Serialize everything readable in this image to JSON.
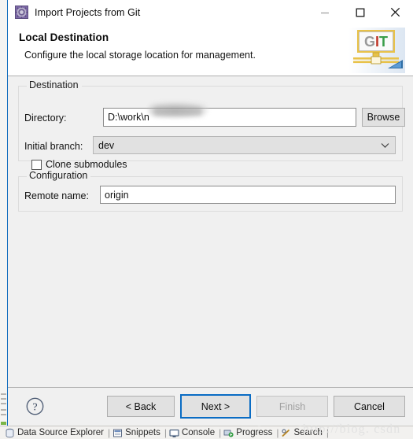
{
  "window": {
    "title": "Import Projects from Git",
    "icon": "eclipse-wizard-icon",
    "controls": {
      "minimize": "minimize-icon",
      "maximize": "maximize-icon",
      "close": "close-icon"
    }
  },
  "header": {
    "title": "Local Destination",
    "subtitle": "Configure the local storage location for management.",
    "logo_text": "GIT"
  },
  "destination": {
    "legend": "Destination",
    "directory_label": "Directory:",
    "directory_value": "D:\\work\\n",
    "directory_placeholder": "",
    "browse_label": "Browse",
    "branch_label": "Initial branch:",
    "branch_value": "dev",
    "clone_submodules_label": "Clone submodules",
    "clone_submodules_checked": false
  },
  "configuration": {
    "legend": "Configuration",
    "remote_label": "Remote name:",
    "remote_value": "origin",
    "remote_placeholder": ""
  },
  "buttons": {
    "help": "?",
    "back": "< Back",
    "next": "Next >",
    "finish": "Finish",
    "cancel": "Cancel"
  },
  "watermark": {
    "text": "http://blog. csdn. net/",
    "text2": "http://blog. csdn"
  },
  "eclipse_tabs": [
    {
      "label": "Data Source Explorer",
      "icon": "database-icon"
    },
    {
      "label": "Snippets",
      "icon": "snippets-icon"
    },
    {
      "label": "Console",
      "icon": "console-icon"
    },
    {
      "label": "Progress",
      "icon": "progress-icon"
    },
    {
      "label": "Search",
      "icon": "search-icon"
    }
  ],
  "colors": {
    "accent": "#0a6cc4",
    "dialog_bg": "#f0f0f0",
    "header_bg": "#ffffff",
    "button_bg": "#e1e1e1"
  }
}
